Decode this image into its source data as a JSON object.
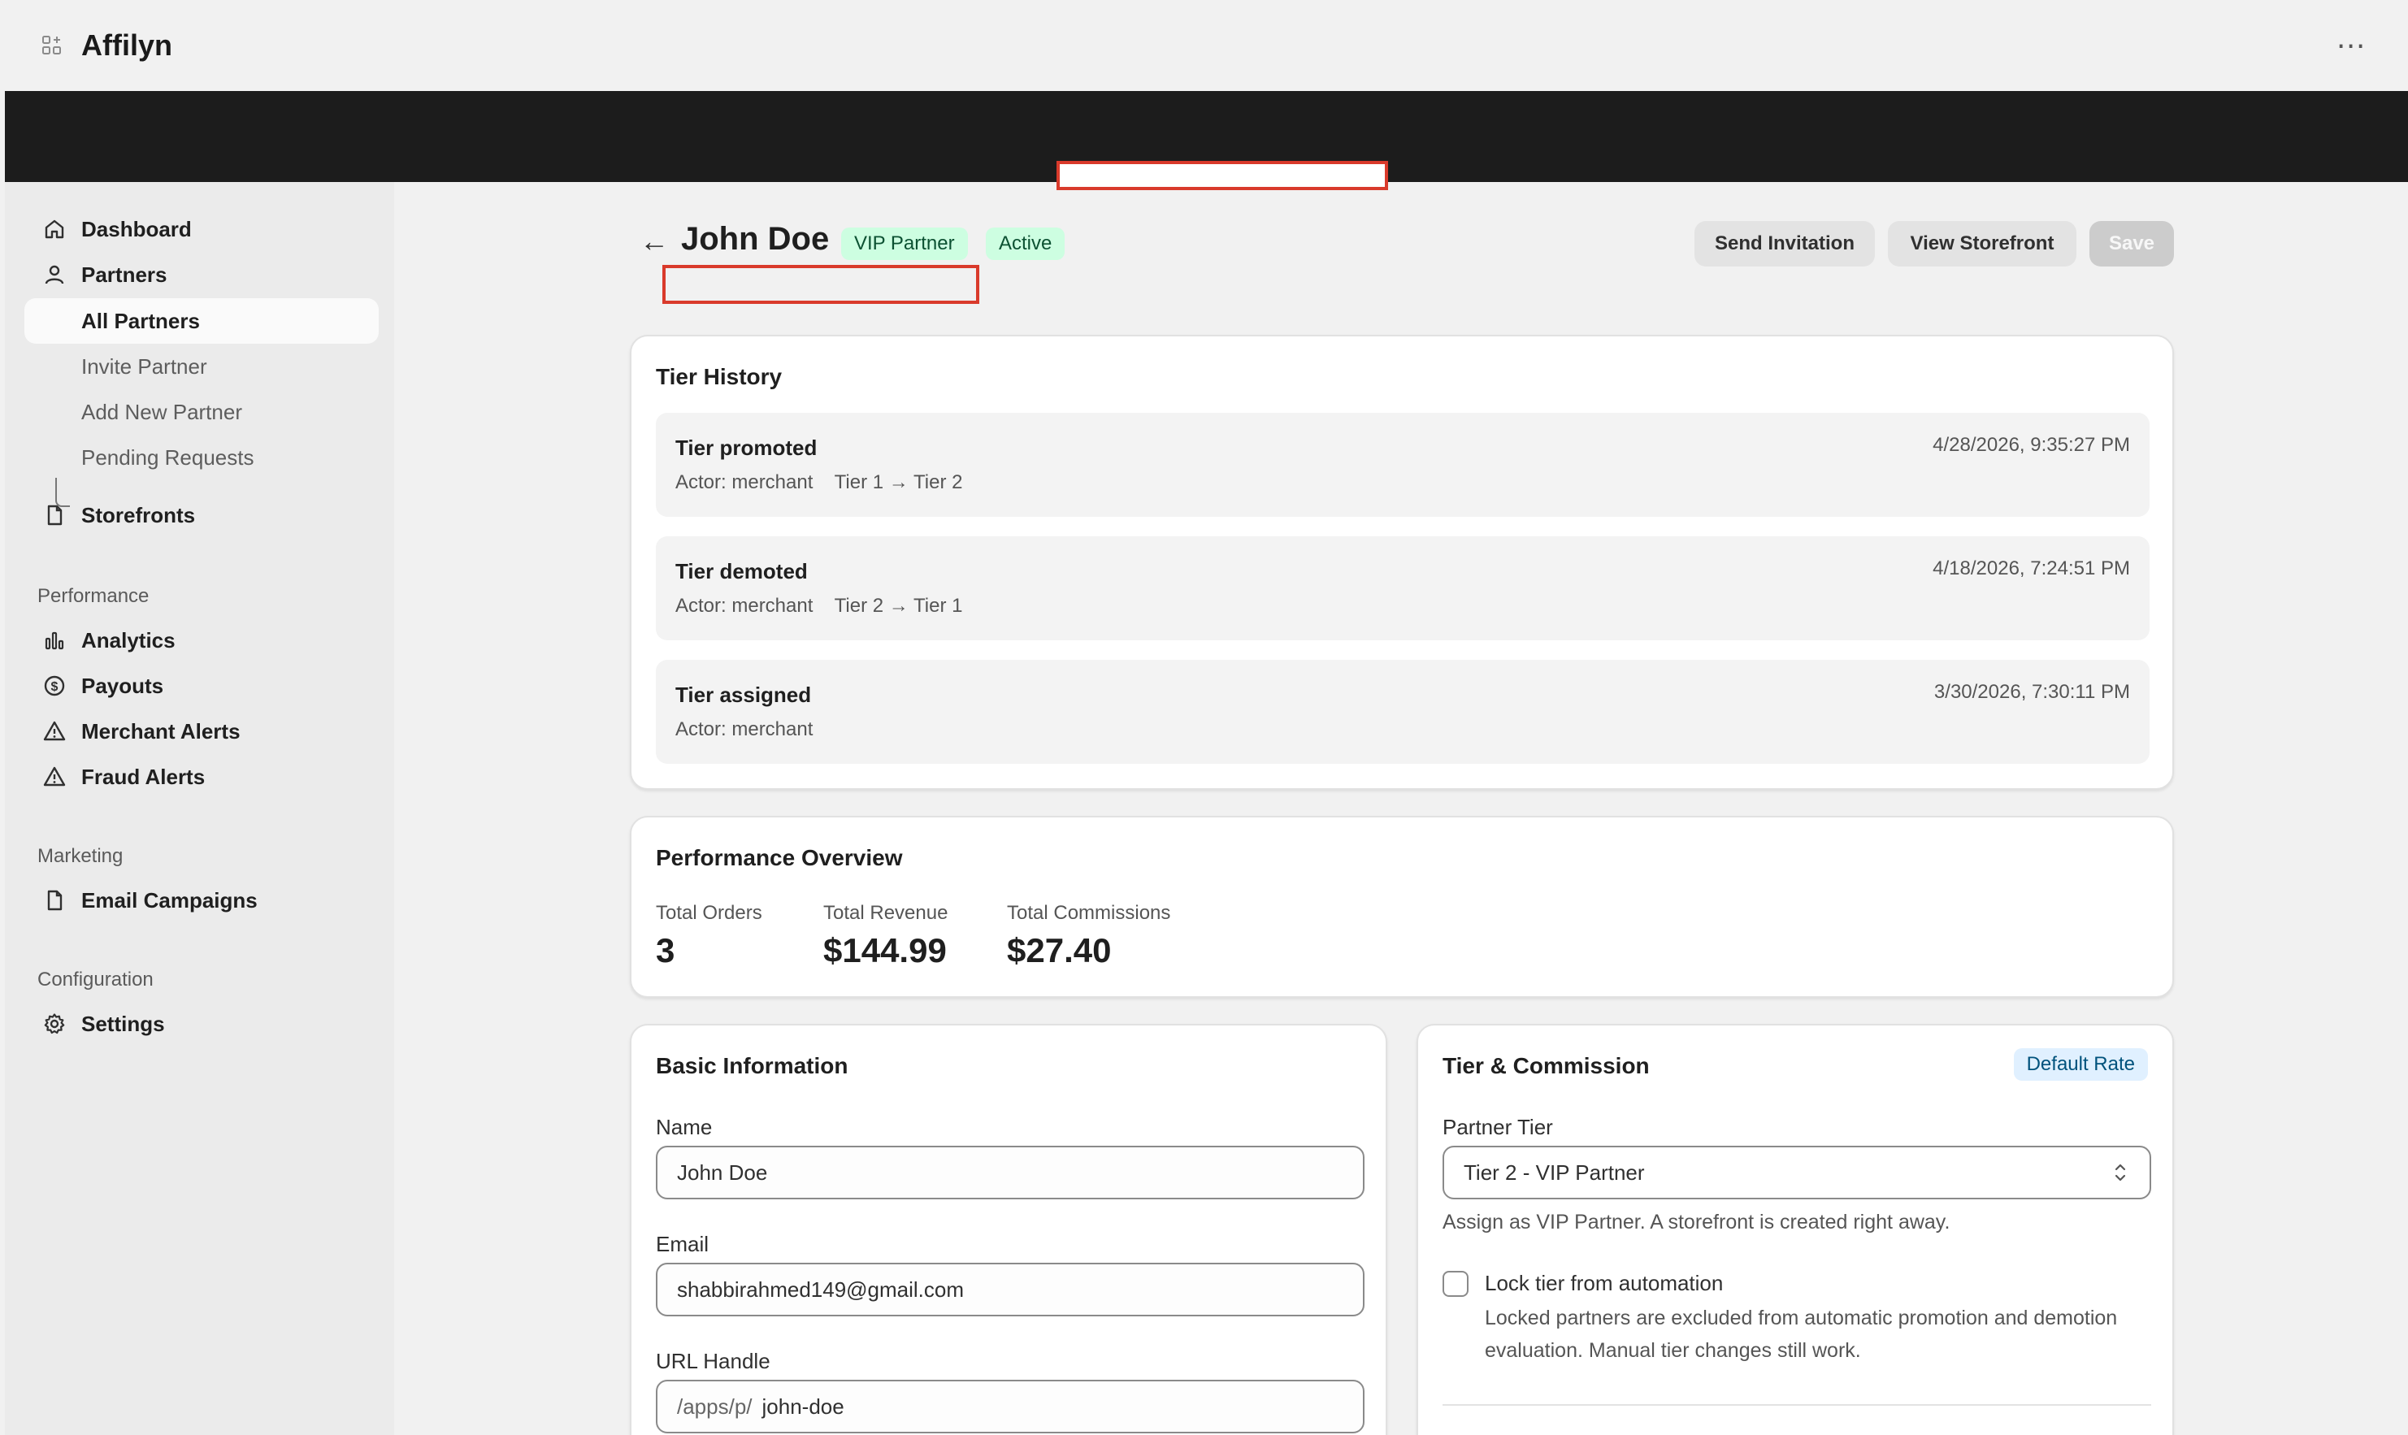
{
  "app": {
    "title": "Affilyn",
    "logo_icon": "app-grid-icon",
    "more_icon": "more-horizontal-icon",
    "more_label": "⋯"
  },
  "sidebar": {
    "items": [
      {
        "label": "Dashboard",
        "icon": "home-icon"
      },
      {
        "label": "Partners",
        "icon": "person-icon"
      },
      {
        "label": "All Partners"
      },
      {
        "label": "Invite Partner"
      },
      {
        "label": "Add New Partner"
      },
      {
        "label": "Pending Requests"
      },
      {
        "label": "Storefronts",
        "icon": "file-icon"
      }
    ],
    "sections": [
      {
        "label": "Performance",
        "items": [
          {
            "label": "Analytics",
            "icon": "bar-chart-icon"
          },
          {
            "label": "Payouts",
            "icon": "dollar-circle-icon"
          },
          {
            "label": "Merchant Alerts",
            "icon": "alert-triangle-icon"
          },
          {
            "label": "Fraud Alerts",
            "icon": "alert-triangle-icon"
          }
        ]
      },
      {
        "label": "Marketing",
        "items": [
          {
            "label": "Email Campaigns",
            "icon": "file-icon"
          }
        ]
      },
      {
        "label": "Configuration",
        "items": [
          {
            "label": "Settings",
            "icon": "gear-icon"
          }
        ]
      }
    ]
  },
  "header": {
    "back_icon": "arrow-left-icon",
    "back_glyph": "←",
    "title": "John Doe",
    "badges": [
      "VIP Partner",
      "Active"
    ],
    "buttons": {
      "send_invitation": "Send Invitation",
      "view_storefront": "View Storefront",
      "save": "Save"
    }
  },
  "tier_history": {
    "title": "Tier History",
    "entries": [
      {
        "title": "Tier promoted",
        "actor": "Actor: merchant",
        "change": "Tier 1 → Tier 2",
        "date": "4/28/2026, 9:35:27 PM"
      },
      {
        "title": "Tier demoted",
        "actor": "Actor: merchant",
        "change": "Tier 2 → Tier 1",
        "date": "4/18/2026, 7:24:51 PM"
      },
      {
        "title": "Tier assigned",
        "actor": "Actor: merchant",
        "change": "",
        "date": "3/30/2026, 7:30:11 PM"
      }
    ]
  },
  "performance": {
    "title": "Performance Overview",
    "metrics": [
      {
        "label": "Total Orders",
        "value": "3"
      },
      {
        "label": "Total Revenue",
        "value": "$144.99"
      },
      {
        "label": "Total Commissions",
        "value": "$27.40"
      }
    ]
  },
  "basic_info": {
    "title": "Basic Information",
    "name_label": "Name",
    "name_value": "John Doe",
    "email_label": "Email",
    "email_value": "shabbirahmed149@gmail.com",
    "handle_label": "URL Handle",
    "handle_prefix": "/apps/p/",
    "handle_value": "john-doe"
  },
  "tier_commission": {
    "title": "Tier & Commission",
    "rate_badge": "Default Rate",
    "tier_label": "Partner Tier",
    "tier_value": "Tier 2 - VIP Partner",
    "tier_help": "Assign as VIP Partner. A storefront is created right away.",
    "lock_label": "Lock tier from automation",
    "lock_help": "Locked partners are excluded from automatic promotion and demotion evaluation. Manual tier changes still work.",
    "lock_checked": false
  },
  "colors": {
    "accent_success": "#cdfee1",
    "accent_info": "#e0f0ff",
    "highlight_red": "#d93a2b",
    "header_dark": "#1c1c1c"
  }
}
